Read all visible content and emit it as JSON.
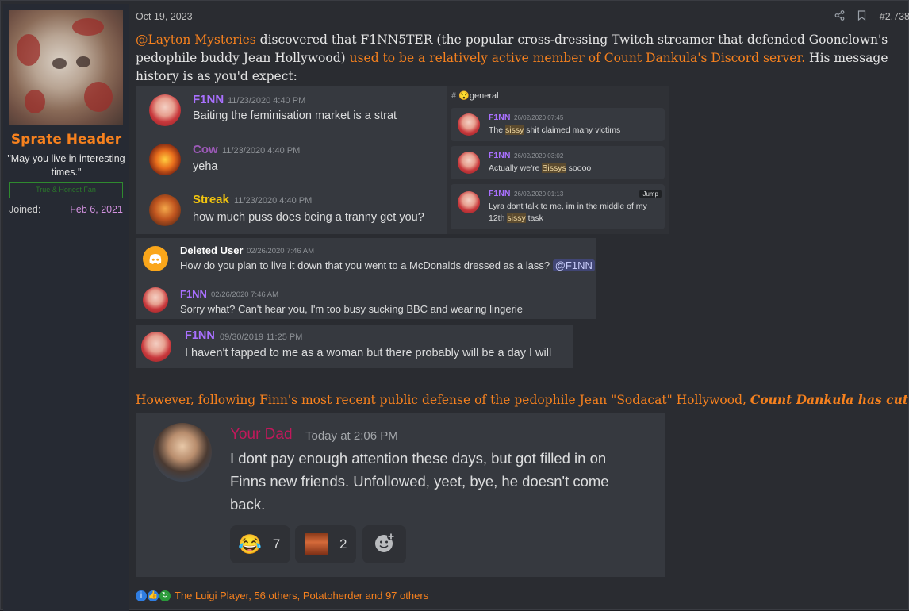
{
  "post": {
    "date": "Oct 19, 2023",
    "post_number": "#2,738",
    "share_icon": "share-icon",
    "bookmark_icon": "bookmark-icon"
  },
  "user": {
    "name": "Sprate Header",
    "title": "\"May you live in interesting times.\"",
    "banner": "True & Honest Fan",
    "joined_label": "Joined:",
    "joined_value": "Feb 6, 2021"
  },
  "body": {
    "mention": "@Layton Mysteries",
    "text1": " discovered that F1NN5TER (the popular cross-dressing Twitch streamer that defended Goonclown's pedophile buddy Jean Hollywood) ",
    "link": "used to be a relatively active member of Count Dankula's Discord server.",
    "text2": " His message history is as you'd expect:"
  },
  "discord1": [
    {
      "name": "F1NN",
      "ts": "11/23/2020 4:40 PM",
      "text": "Baiting the feminisation market is a strat"
    },
    {
      "name": "Cow",
      "ts": "11/23/2020 4:40 PM",
      "text": "yeha"
    },
    {
      "name": "Streak",
      "ts": "11/23/2020 4:40 PM",
      "text": "how much puss does being a tranny get you?"
    }
  ],
  "discord2": {
    "channel": "general",
    "messages": [
      {
        "name": "F1NN",
        "ts": "26/02/2020 07:45",
        "pre": "The ",
        "hl": "sissy",
        "post": " shit claimed many victims"
      },
      {
        "name": "F1NN",
        "ts": "26/02/2020 03:02",
        "pre": "Actually we're ",
        "hl": "Sissys",
        "post": " soooo"
      },
      {
        "name": "F1NN",
        "ts": "26/02/2020 01:13",
        "pre": "Lyra dont talk to me, im in the middle of my",
        "pre2": "12th ",
        "hl": "sissy",
        "post": " task",
        "jump": "Jump"
      }
    ]
  },
  "discord3": [
    {
      "name": "Deleted User",
      "ts": "02/26/2020 7:46 AM",
      "text": "How do you plan to live it down that you went to a McDonalds dressed as a lass?",
      "mention": "@F1NN"
    },
    {
      "name": "F1NN",
      "ts": "02/26/2020 7:46 AM",
      "text": "Sorry what? Can't hear you, I'm too busy sucking BBC and wearing lingerie"
    }
  ],
  "discord4": {
    "name": "F1NN",
    "ts": "09/30/2019 11:25 PM",
    "text": "I haven't fapped to me as a woman but there probably will be a day I will"
  },
  "cut": {
    "text": "However, following Finn's most recent public defense of the pedophile Jean \"Sodacat\" Hollywood, ",
    "bold": "Count Dankula has cut ties"
  },
  "discord5": {
    "name": "Your Dad",
    "ts": "Today at 2:06 PM",
    "line1": "I dont pay enough attention these days, but got filled in on",
    "line2": "Finns new friends. Unfollowed, yeet, bye, he doesn't come",
    "line3": "back.",
    "r1_emoji": "😂",
    "r1_count": "7",
    "r2_count": "2",
    "r3_icon": "add-reaction-icon"
  },
  "reactions": {
    "text": "The Luigi Player, 56 others, Potatoherder and 97 others"
  },
  "colors": {
    "accent": "#f6811e",
    "finn_name": "#a970ff",
    "cow_name": "#9b59b6",
    "streak_name": "#f1c40f",
    "your_dad": "#c2185b"
  }
}
